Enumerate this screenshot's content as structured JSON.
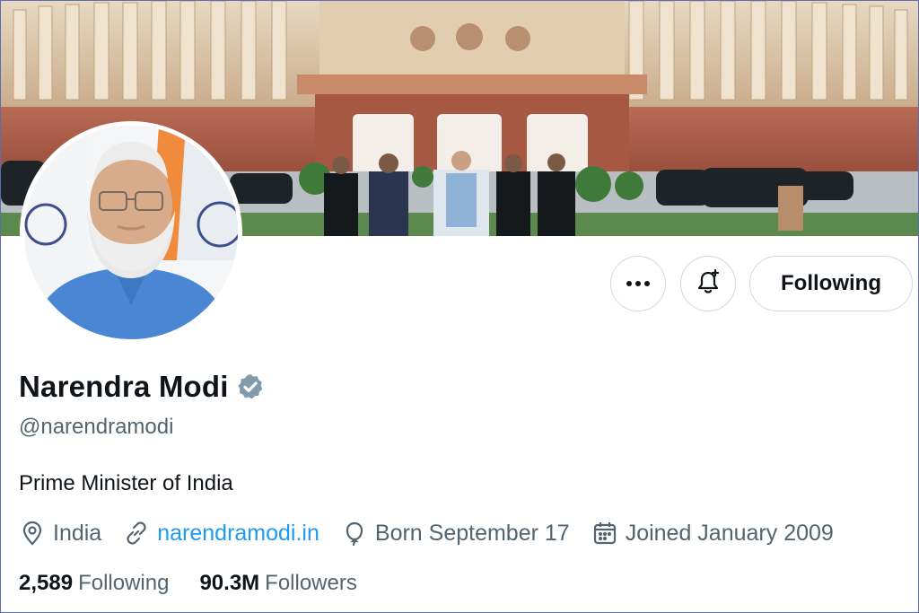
{
  "profile": {
    "name": "Narendra Modi",
    "handle": "@narendramodi",
    "bio": "Prime Minister of India",
    "location": "India",
    "website": "narendramodi.in",
    "birthday": "Born September 17",
    "joined": "Joined January 2009"
  },
  "actions": {
    "follow_label": "Following"
  },
  "stats": {
    "following_count": "2,589",
    "following_label": "Following",
    "followers_count": "90.3M",
    "followers_label": "Followers"
  },
  "icons": {
    "more": "more-icon",
    "notify": "bell-plus-icon",
    "verified": "verified-badge-icon",
    "location": "location-pin-icon",
    "link": "link-icon",
    "birthday": "balloon-icon",
    "joined": "calendar-icon"
  },
  "colors": {
    "accent": "#1d9bf0",
    "text_primary": "#0f1419",
    "text_secondary": "#536471",
    "border": "#cfd9de",
    "verified_badge": "#829aab"
  }
}
